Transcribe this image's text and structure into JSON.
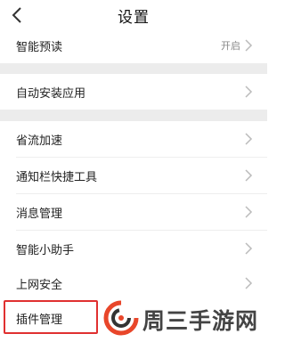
{
  "header": {
    "title": "设置",
    "back_icon": "chevron-left-icon"
  },
  "settings": {
    "items": [
      {
        "label": "智能预读",
        "value": "开启"
      },
      {
        "label": "自动安装应用"
      },
      {
        "label": "省流加速"
      },
      {
        "label": "通知栏快捷工具"
      },
      {
        "label": "消息管理"
      },
      {
        "label": "智能小助手"
      },
      {
        "label": "上网安全"
      },
      {
        "label": "插件管理"
      }
    ]
  },
  "highlight": {
    "color": "#e03030"
  },
  "watermark": {
    "text": "周三手游网",
    "logo_icon": "spiral-logo-icon"
  },
  "colors": {
    "background": "#ffffff",
    "section_gap": "#ececec",
    "chevron": "#bbbbbb"
  }
}
